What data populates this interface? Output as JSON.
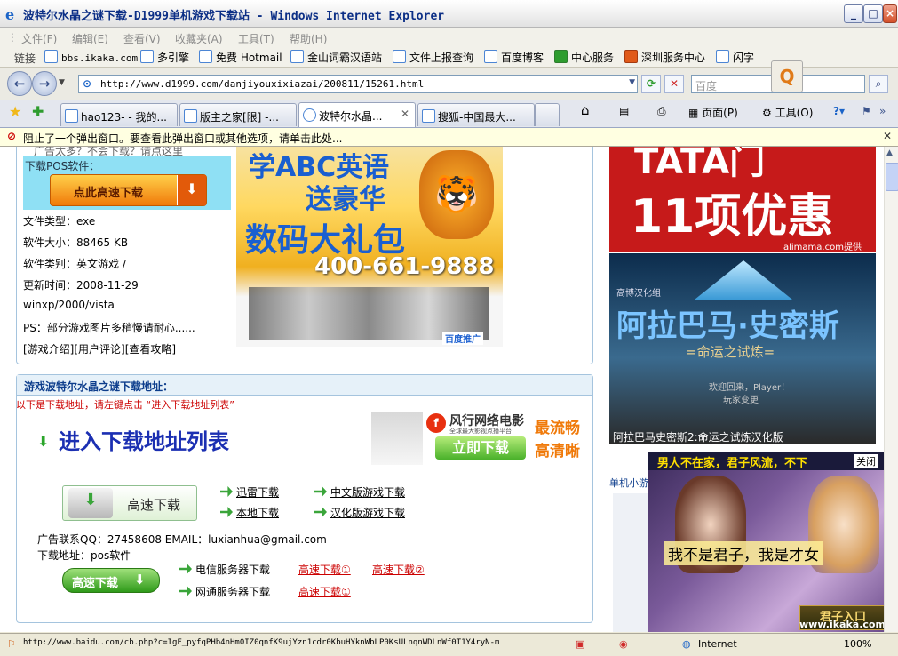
{
  "window": {
    "title": "波特尔水晶之谜下载-D1999单机游戏下载站 - Windows Internet Explorer"
  },
  "menu": [
    "文件(F)",
    "编辑(E)",
    "查看(V)",
    "收藏夹(A)",
    "工具(T)",
    "帮助(H)"
  ],
  "links_bar": {
    "label": "链接",
    "items": [
      "bbs.ikaka.com",
      "多引擎",
      "免费 Hotmail",
      "金山词霸汉语站",
      "文件上报查询",
      "百度博客",
      "中心服务",
      "深圳服务中心",
      "闪字"
    ]
  },
  "address_bar": {
    "url": "http://www.d1999.com/danjiyouxixiazai/200811/15261.html",
    "search_placeholder": "百度"
  },
  "tabs": [
    {
      "label": "hao123- - 我的..."
    },
    {
      "label": "版主之家[限] -..."
    },
    {
      "label": "波特尔水晶..."
    },
    {
      "label": "搜狐-中国最大..."
    }
  ],
  "command_bar": {
    "page": "页面(P)",
    "tools": "工具(O)"
  },
  "info_bar": {
    "message": "阻止了一个弹出窗口。要查看此弹出窗口或其他选项，请单击此处..."
  },
  "page": {
    "download_pos_label": "下载POS软件：",
    "cutoff_text": "广告太多？不会下载？请点这里",
    "fast_download_btn": "点此高速下载",
    "file_info": [
      "文件类型：exe",
      "软件大小：88465 KB",
      "软件类别：英文游戏 /",
      "更新时间：2008-11-29",
      "winxp/2000/vista",
      "PS：部分游戏图片多稍慢请耐心......"
    ],
    "bottom_links": [
      "[游戏介绍]",
      "[用户评论]",
      "[查看攻略]"
    ],
    "ad_abc": {
      "line1": "学ABC英语",
      "line2": "送豪华",
      "line3": "数码大礼包",
      "phone": "400-661-9888",
      "footer": "百度推广"
    },
    "address_section": {
      "title": "游戏波特尔水晶之谜下载地址：",
      "hint": "以下是下载地址，请左键点击 “进入下载地址列表”",
      "enter_list": "进入下载地址列表",
      "high_speed": "高速下载",
      "links_col1": [
        "迅雷下载",
        "本地下载"
      ],
      "links_col2": [
        "中文版游戏下载",
        "汉化版游戏下载"
      ],
      "contact": "广告联系QQ：27458608 EMAIL：luxianhua@gmail.com",
      "download_addr": "下载地址：pos软件",
      "high_speed_btn2": "高速下载",
      "telecom_label": "电信服务器下载",
      "telecom_links": [
        "高速下载①",
        "高速下载②"
      ],
      "netcom_label": "网通服务器下载",
      "netcom_links": [
        "高速下载①"
      ]
    },
    "ad_movie": {
      "brand": "风行网络电影",
      "sub": "全球最大影视点播平台",
      "btn": "立即下载",
      "slogan1": "最流畅",
      "slogan2": "高清晰"
    },
    "right_ads": {
      "ad1_top": "TATA门",
      "ad1_main": "11项优惠",
      "ad1_provider": "alimama.com提供",
      "ad2_group": "高博汉化组",
      "ad2_title": "阿拉巴马·史密斯",
      "ad2_sub": "=命运之试炼=",
      "ad2_welcome": "欢迎回来，Player！",
      "ad2_change": "玩家变更",
      "ad2_caption": "阿拉巴马史密斯2:命运之试炼汉化版",
      "ad_girl_top": "男人不在家，君子风流，不下",
      "ad_girl_close": "关闭",
      "ad_girl_line": "我不是君子，我是才女",
      "ad_girl_btn": "君子入口",
      "side_text": "单机小游"
    }
  },
  "status_bar": {
    "url": "http://www.baidu.com/cb.php?c=IgF_pyfqPHb4nHm0IZ0qnfK9ujYzn1cdr0KbuHYknWbLP0KsULnqnWDLnWf0T1Y4ryN-m",
    "zone": "Internet",
    "zoom": "100%",
    "watermark": "www.ikaka.com"
  }
}
